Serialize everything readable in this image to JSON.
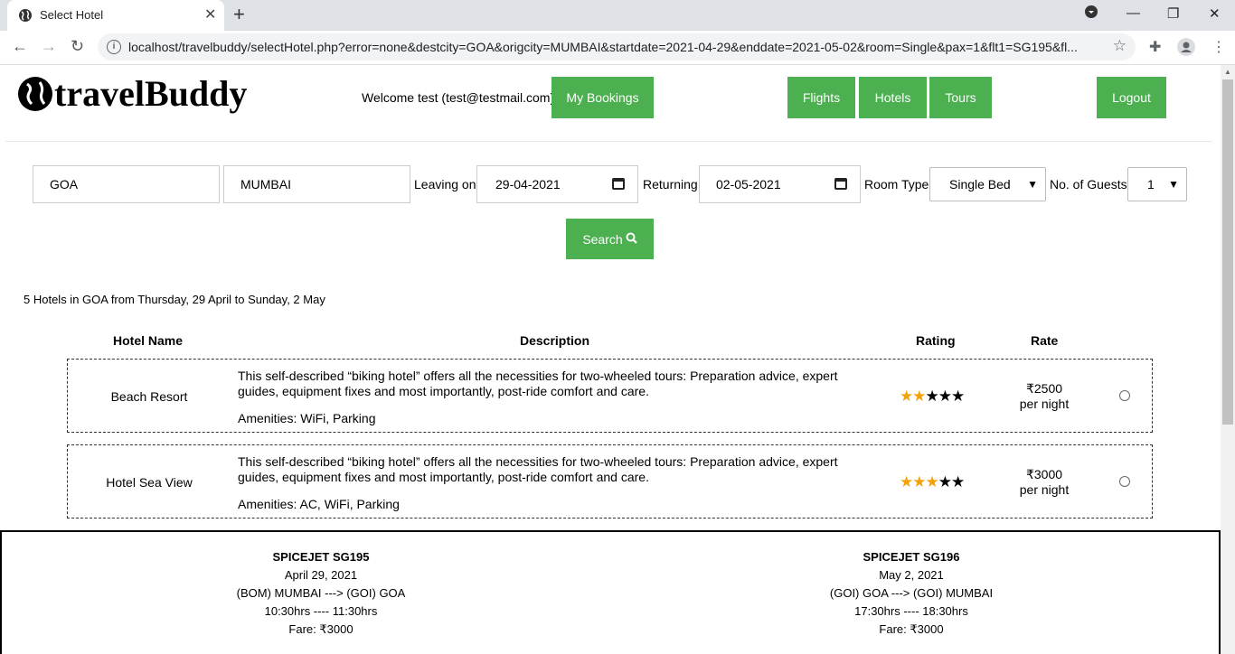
{
  "browser": {
    "tab_title": "Select Hotel",
    "url": "localhost/travelbuddy/selectHotel.php?error=none&destcity=GOA&origcity=MUMBAI&startdate=2021-04-29&enddate=2021-05-02&room=Single&pax=1&flt1=SG195&fl..."
  },
  "header": {
    "logo_text": "travelBuddy",
    "welcome": "Welcome test (test@testmail.com)",
    "my_bookings": "My Bookings",
    "flights": "Flights",
    "hotels": "Hotels",
    "tours": "Tours",
    "logout": "Logout"
  },
  "search": {
    "dest": "GOA",
    "orig": "MUMBAI",
    "leaving_label": "Leaving on",
    "leaving_date": "29-04-2021",
    "returning_label": "Returning",
    "returning_date": "02-05-2021",
    "room_label": "Room Type",
    "room_value": "Single Bed",
    "guests_label": "No. of Guests",
    "guests_value": "1",
    "search_button": "Search"
  },
  "results": {
    "summary": "5 Hotels in GOA from Thursday, 29 April to Sunday, 2 May",
    "columns": {
      "name": "Hotel Name",
      "description": "Description",
      "rating": "Rating",
      "rate": "Rate"
    },
    "hotels": [
      {
        "name": "Beach Resort",
        "description": "This self-described “biking hotel” offers all the necessities for two-wheeled tours: Preparation advice, expert guides, equipment fixes and most importantly, post-ride comfort and care.",
        "amenities": "Amenities: WiFi, Parking",
        "rating": 2,
        "price": "₹2500",
        "per": "per night"
      },
      {
        "name": "Hotel Sea View",
        "description": "This self-described “biking hotel” offers all the necessities for two-wheeled tours: Preparation advice, expert guides, equipment fixes and most importantly, post-ride comfort and care.",
        "amenities": "Amenities: AC, WiFi, Parking",
        "rating": 3,
        "price": "₹3000",
        "per": "per night"
      }
    ]
  },
  "flights": [
    {
      "name": "SPICEJET SG195",
      "date": "April 29, 2021",
      "route": "(BOM) MUMBAI ---> (GOI) GOA",
      "time": "10:30hrs ---- 11:30hrs",
      "fare": "Fare: ₹3000"
    },
    {
      "name": "SPICEJET SG196",
      "date": "May 2, 2021",
      "route": "(GOI) GOA ---> (GOI) MUMBAI",
      "time": "17:30hrs ---- 18:30hrs",
      "fare": "Fare: ₹3000"
    }
  ],
  "colors": {
    "green": "#4caf50",
    "star": "#f4a20c"
  }
}
